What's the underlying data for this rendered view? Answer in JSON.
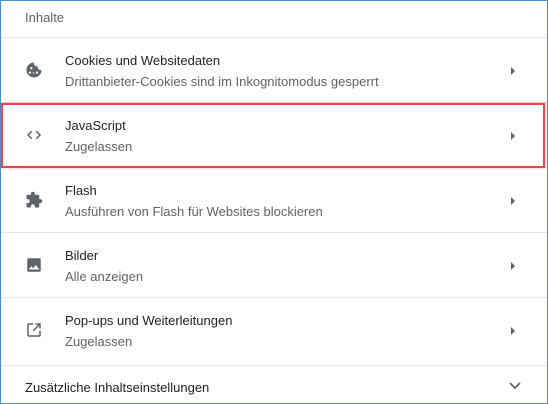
{
  "section": {
    "title": "Inhalte"
  },
  "rows": [
    {
      "title": "Cookies und Websitedaten",
      "subtitle": "Drittanbieter-Cookies sind im Inkognitomodus gesperrt",
      "icon": "cookie-icon"
    },
    {
      "title": "JavaScript",
      "subtitle": "Zugelassen",
      "icon": "code-icon"
    },
    {
      "title": "Flash",
      "subtitle": "Ausführen von Flash für Websites blockieren",
      "icon": "puzzle-icon"
    },
    {
      "title": "Bilder",
      "subtitle": "Alle anzeigen",
      "icon": "image-icon"
    },
    {
      "title": "Pop-ups und Weiterleitungen",
      "subtitle": "Zugelassen",
      "icon": "open-in-new-icon"
    }
  ],
  "footer": {
    "label": "Zusätzliche Inhaltseinstellungen",
    "icon": "chevron-down-icon"
  },
  "colors": {
    "highlight": "#e8474e",
    "frame": "#4a90c8",
    "icon": "#5f6368"
  }
}
